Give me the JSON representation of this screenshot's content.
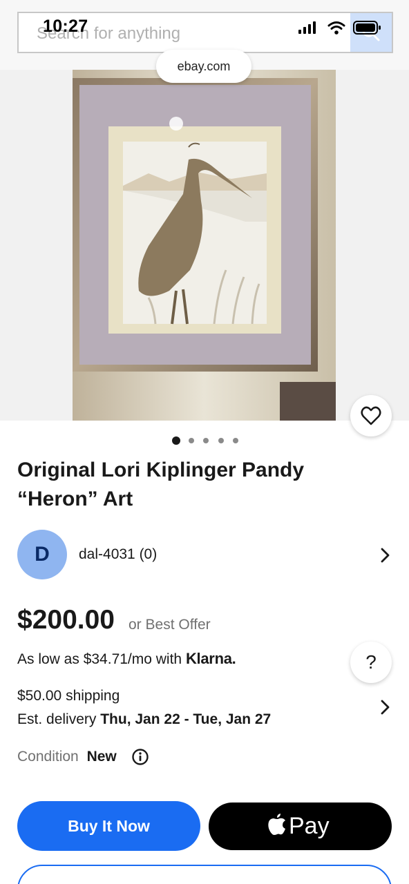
{
  "status_bar": {
    "time": "10:27"
  },
  "search": {
    "placeholder": "Search for anything"
  },
  "browser": {
    "url": "ebay.com"
  },
  "gallery": {
    "image_count": 5,
    "active_index": 0
  },
  "listing": {
    "title": "Original Lori Kiplinger Pandy “Heron” Art",
    "seller": {
      "initial": "D",
      "name": "dal-4031 (0)"
    },
    "price": "$200.00",
    "best_offer": "or Best Offer",
    "klarna": {
      "prefix": "As low as $34.71/mo with",
      "brand": "Klarna."
    },
    "help_label": "?",
    "shipping": "$50.00 shipping",
    "delivery": {
      "label": "Est. delivery",
      "range": "Thu, Jan 22 - Tue, Jan 27"
    },
    "condition": {
      "label": "Condition",
      "value": "New"
    }
  },
  "actions": {
    "buy_now": "Buy It Now",
    "apple_pay": "Pay"
  },
  "colors": {
    "accent": "#1a6cf2",
    "avatar": "#8fb5f0"
  },
  "icons": [
    "search-icon",
    "signal-icon",
    "wifi-icon",
    "battery-icon",
    "heart-icon",
    "chevron-right-icon",
    "info-icon",
    "apple-icon"
  ]
}
